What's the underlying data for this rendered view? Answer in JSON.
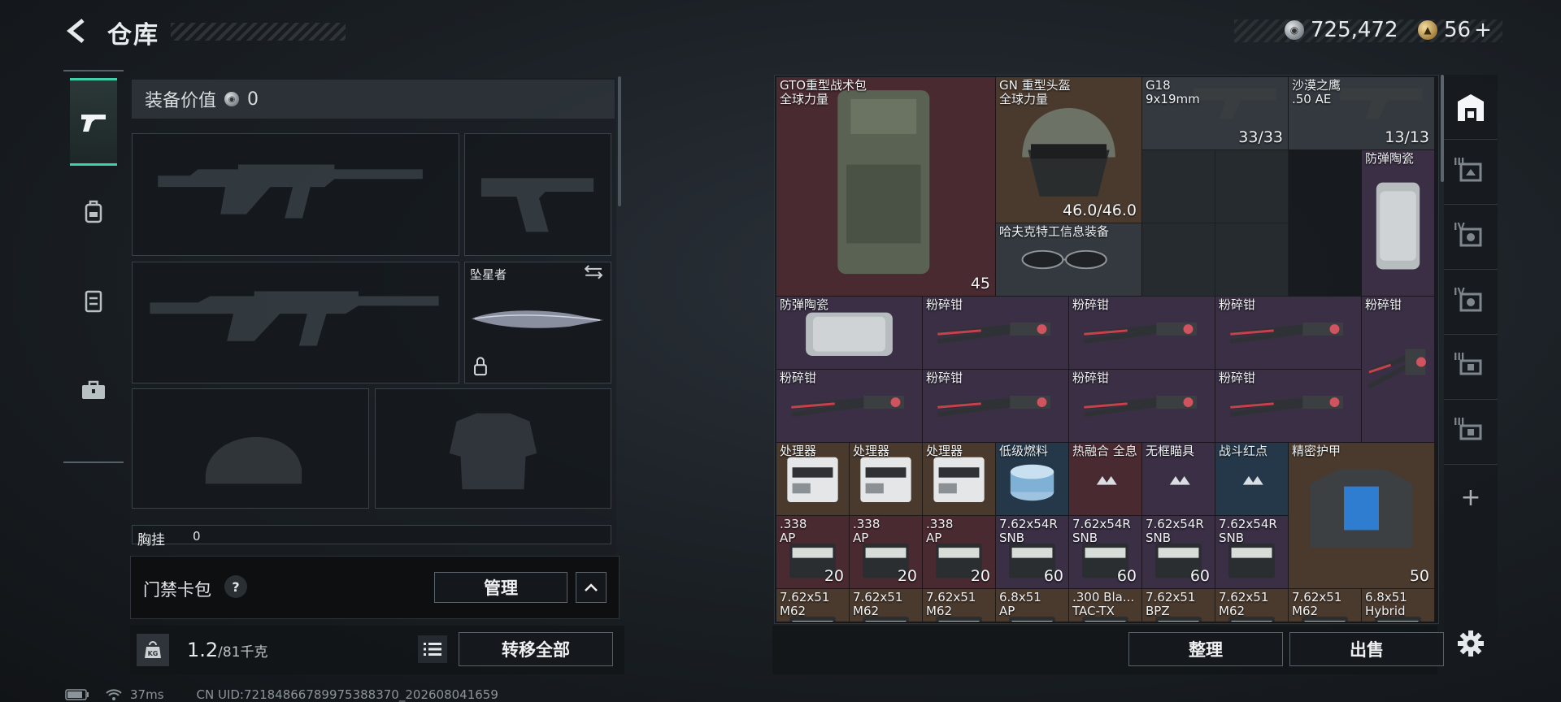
{
  "header": {
    "title": "仓库",
    "currency_silver": "725,472",
    "currency_gold": "56",
    "gold_plus": "+"
  },
  "left_tabs": [
    {
      "icon": "pistol-icon",
      "active": true
    },
    {
      "icon": "backpack-icon",
      "active": false
    },
    {
      "icon": "vest-icon",
      "active": false
    },
    {
      "icon": "toolbox-icon",
      "active": false
    }
  ],
  "equipment": {
    "header_label": "装备价值",
    "header_value": "0",
    "melee_name": "坠星者",
    "chest_label": "胸挂",
    "chest_value": "0"
  },
  "keycard": {
    "label": "门禁卡包",
    "help": "?",
    "manage_button": "管理"
  },
  "weight": {
    "current": "1.2",
    "max_unit": "/81千克",
    "icon_label": "KG",
    "transfer_all_button": "转移全部"
  },
  "status": {
    "ping": "37ms",
    "uid": "CN UID:72184866789975388370_202608041659"
  },
  "inventory": {
    "items": [
      {
        "name": "GTO重型战术包",
        "sub": "全球力量",
        "color": "red",
        "count": "45",
        "icon": "backpack-icon"
      },
      {
        "name": "GN 重型头盔",
        "sub": "全球力量",
        "color": "brown",
        "count": "46.0/46.0",
        "icon": "helmet-icon"
      },
      {
        "name": "G18",
        "sub": "9x19mm",
        "color": "gray",
        "count": "33/33",
        "icon": "pistol-icon"
      },
      {
        "name": "沙漠之鹰",
        "sub": ".50 AE",
        "color": "gray",
        "count": "13/13",
        "icon": "pistol-icon"
      },
      {
        "name": "防弹陶瓷",
        "color": "purple",
        "icon": "plate-icon"
      },
      {
        "name": "哈夫克特工信息装备",
        "color": "gray",
        "icon": "glasses-icon"
      },
      {
        "name": "防弹陶瓷",
        "color": "purple",
        "icon": "plate-icon"
      },
      {
        "name": "粉碎钳",
        "color": "purple",
        "icon": "cutter-icon"
      },
      {
        "name": "粉碎钳",
        "color": "purple",
        "icon": "cutter-icon"
      },
      {
        "name": "粉碎钳",
        "color": "purple",
        "icon": "cutter-icon"
      },
      {
        "name": "粉碎钳",
        "color": "purple",
        "icon": "cutter-icon"
      },
      {
        "name": "粉碎钳",
        "color": "purple",
        "icon": "cutter-icon"
      },
      {
        "name": "粉碎钳",
        "color": "purple",
        "icon": "cutter-icon"
      },
      {
        "name": "粉碎钳",
        "color": "purple",
        "icon": "cutter-icon"
      },
      {
        "name": "粉碎钳",
        "color": "purple",
        "icon": "cutter-icon"
      },
      {
        "name": "处理器",
        "color": "brown",
        "icon": "processor-icon"
      },
      {
        "name": "处理器",
        "color": "brown",
        "icon": "processor-icon"
      },
      {
        "name": "处理器",
        "color": "brown",
        "icon": "processor-icon"
      },
      {
        "name": "低级燃料",
        "color": "blue",
        "icon": "fuel-icon"
      },
      {
        "name": "热融合 全息",
        "color": "red",
        "icon": "sight-icon"
      },
      {
        "name": "无框瞄具",
        "color": "purple",
        "icon": "sight-icon"
      },
      {
        "name": "战斗红点",
        "color": "blue",
        "icon": "sight-icon"
      },
      {
        "name": "精密护甲",
        "color": "brown",
        "count": "50",
        "icon": "armor-icon"
      },
      {
        "name": ".338",
        "sub": "AP",
        "color": "red",
        "count": "20",
        "icon": "ammo-box-icon"
      },
      {
        "name": ".338",
        "sub": "AP",
        "color": "red",
        "count": "20",
        "icon": "ammo-box-icon"
      },
      {
        "name": ".338",
        "sub": "AP",
        "color": "red",
        "count": "20",
        "icon": "ammo-box-icon"
      },
      {
        "name": "7.62x54R",
        "sub": "SNB",
        "color": "purple",
        "count": "60",
        "icon": "ammo-box-icon"
      },
      {
        "name": "7.62x54R",
        "sub": "SNB",
        "color": "purple",
        "count": "60",
        "icon": "ammo-box-icon"
      },
      {
        "name": "7.62x54R",
        "sub": "SNB",
        "color": "purple",
        "count": "60",
        "icon": "ammo-box-icon"
      },
      {
        "name": "7.62x54R",
        "sub": "SNB",
        "color": "purple",
        "icon": "ammo-box-icon"
      },
      {
        "name": "7.62x51",
        "sub": "M62",
        "color": "brown",
        "icon": "ammo-box-icon"
      },
      {
        "name": "7.62x51",
        "sub": "M62",
        "color": "brown",
        "icon": "ammo-box-icon"
      },
      {
        "name": "7.62x51",
        "sub": "M62",
        "color": "brown",
        "icon": "ammo-box-icon"
      },
      {
        "name": "6.8x51",
        "sub": "AP",
        "color": "brown",
        "icon": "ammo-box-icon"
      },
      {
        "name": ".300 Bla...",
        "sub": "TAC-TX",
        "color": "brown",
        "icon": "ammo-box-icon"
      },
      {
        "name": "7.62x51",
        "sub": "BPZ",
        "color": "brown",
        "icon": "ammo-box-icon"
      },
      {
        "name": "7.62x51",
        "sub": "M62",
        "color": "brown",
        "icon": "ammo-box-icon"
      },
      {
        "name": "7.62x51",
        "sub": "M62",
        "color": "brown",
        "icon": "ammo-box-icon"
      },
      {
        "name": "6.8x51",
        "sub": "Hybrid",
        "color": "brown",
        "icon": "ammo-box-icon"
      }
    ],
    "sort_button": "整理",
    "sell_button": "出售"
  },
  "right_rail": {
    "tiers": [
      "III",
      "IV",
      "IV",
      "III",
      "III"
    ],
    "add": "+"
  },
  "colors": {
    "accent": "#3fd0a9",
    "red_rarity": "#4a2a31",
    "purple_rarity": "#3a2f45",
    "brown_rarity": "#4a3a2e",
    "blue_rarity": "#24384a"
  }
}
